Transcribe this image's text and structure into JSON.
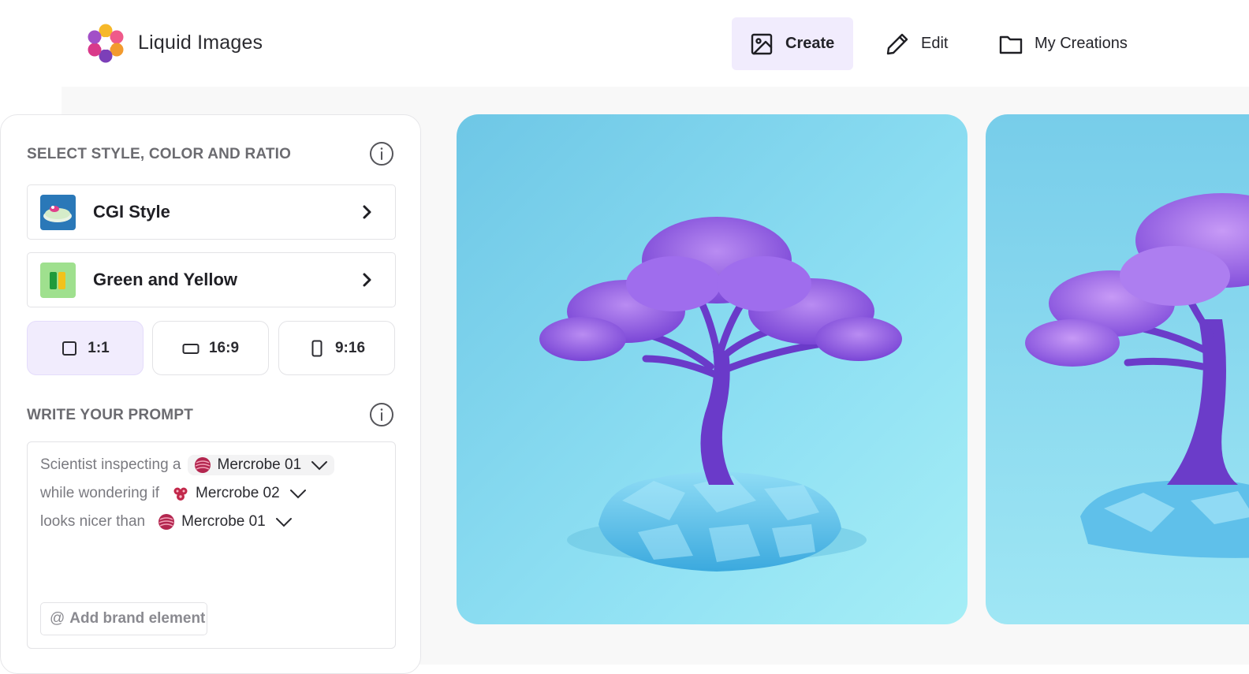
{
  "app": {
    "title": "Liquid Images"
  },
  "nav": {
    "create_label": "Create",
    "edit_label": "Edit",
    "creations_label": "My Creations"
  },
  "panel": {
    "style_section_title": "SELECT STYLE, COLOR AND RATIO",
    "style_selector_label": "CGI Style",
    "color_selector_label": "Green and Yellow",
    "ratios": [
      {
        "label": "1:1",
        "selected": true
      },
      {
        "label": "16:9",
        "selected": false
      },
      {
        "label": "9:16",
        "selected": false
      }
    ],
    "prompt_section_title": "WRITE YOUR PROMPT",
    "prompt_lines": [
      {
        "text": "Scientist inspecting a",
        "element": "Mercrobe 01"
      },
      {
        "text": "while wondering if",
        "element": "Mercrobe 02"
      },
      {
        "text": "looks nicer than",
        "element": "Mercrobe 01"
      }
    ],
    "add_brand_prefix": "@",
    "add_brand_label": "Add brand element"
  },
  "colors": {
    "accent_bg": "#f1ecfd",
    "image_sky": "#8fdcf0",
    "tree_purple": "#8a55e0",
    "rock_blue": "#59c3ea"
  }
}
